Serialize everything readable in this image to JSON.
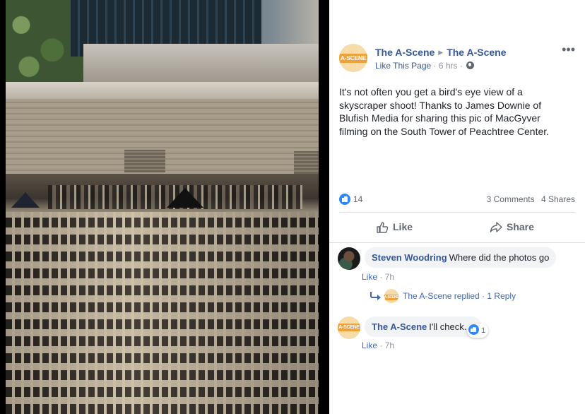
{
  "post": {
    "page_name": "The A-Scene",
    "target_name": "The A-Scene",
    "like_page": "Like This Page",
    "time": "6 hrs",
    "logo_text": "A-SCENE",
    "text": "It's not often you get a bird's eye view of a skyscraper shoot! Thanks to James Downie of Blufish Media for sharing this pic of MacGyver filming on the South Tower of Peachtree Center.",
    "reaction_count": "14",
    "comments_count": "3 Comments",
    "shares_count": "4 Shares",
    "more_icon": "ellipsis-icon",
    "privacy_icon": "globe-icon"
  },
  "actions": {
    "like_label": "Like",
    "share_label": "Share"
  },
  "comments": [
    {
      "author": "Steven Woodring",
      "text": "Where did the photos go",
      "like": "Like",
      "time": "7h",
      "reply_summary": "The A-Scene replied · 1 Reply"
    },
    {
      "author": "The A-Scene",
      "text": "I'll check.",
      "like": "Like",
      "time": "7h",
      "reactions": "1"
    }
  ],
  "colors": {
    "link": "#365899",
    "meta": "#90949c",
    "like_blue": "#2d88ff",
    "brand_orange": "#f0a23a"
  }
}
